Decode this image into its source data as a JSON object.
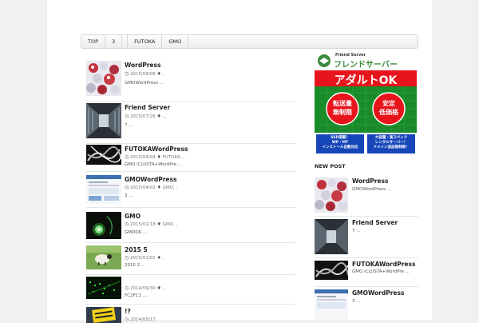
{
  "nav": {
    "items": [
      "TOP",
      "3",
      "FUTOKA",
      "GMO"
    ]
  },
  "posts": [
    {
      "title": "WordPress",
      "date": "2015/08/08",
      "tags": ",",
      "excerpt": "GMOWordPress ...",
      "thumb": "balls-icon"
    },
    {
      "title": "Friend Server",
      "date": "2015/07/26",
      "tags": ", ,",
      "excerpt": "7 ...",
      "thumb": "server-room-icon"
    },
    {
      "title": "FUTOKAWordPress",
      "date": "2015/04/04",
      "tags": "FUTOKA, ,",
      "excerpt": "GMO iCLUSTA+WordPre ...",
      "thumb": "cables-icon"
    },
    {
      "title": "GMOWordPress",
      "date": "2015/04/02",
      "tags": "GMO, ,",
      "excerpt": "3 ...",
      "thumb": "screenshot-icon"
    },
    {
      "title": "GMO",
      "date": "2015/01/18",
      "tags": "GMO, ,",
      "excerpt": "GMOOK ...",
      "thumb": "green-light-icon"
    },
    {
      "title": "2015 5",
      "date": "2015/01/01",
      "tags": ",",
      "excerpt": "2015 2 ...",
      "thumb": "sheep-icon"
    },
    {
      "title": "",
      "date": "2014/09/30",
      "tags": ", ,",
      "excerpt": "FC2FC2 ...",
      "thumb": "network-icon"
    },
    {
      "title": "!?",
      "date": "2014/05/17",
      "tags": "",
      "excerpt": "",
      "thumb": "sign-icon"
    }
  ],
  "ad": {
    "brand_small": "Friend Server",
    "brand": "フレンドサーバー",
    "headline": "アダルトOK",
    "circle1": "転送量\n無制限",
    "circle2": "安定\n低価格",
    "box1": "SSD搭載！\nWP・MT\nインストール自動対応",
    "box2": "大容量・高スペック\nレンタルサーバー！\nドメイン追加無制限！"
  },
  "sidebar": {
    "heading": "NEW POST",
    "items": [
      {
        "title": "WordPress",
        "excerpt": "GMOWordPress ..."
      },
      {
        "title": "Friend Server",
        "excerpt": "7 ..."
      },
      {
        "title": "FUTOKAWordPress",
        "excerpt": "GMO iCLUSTA+WordPre ..."
      },
      {
        "title": "GMOWordPress",
        "excerpt": "3 ..."
      }
    ]
  }
}
